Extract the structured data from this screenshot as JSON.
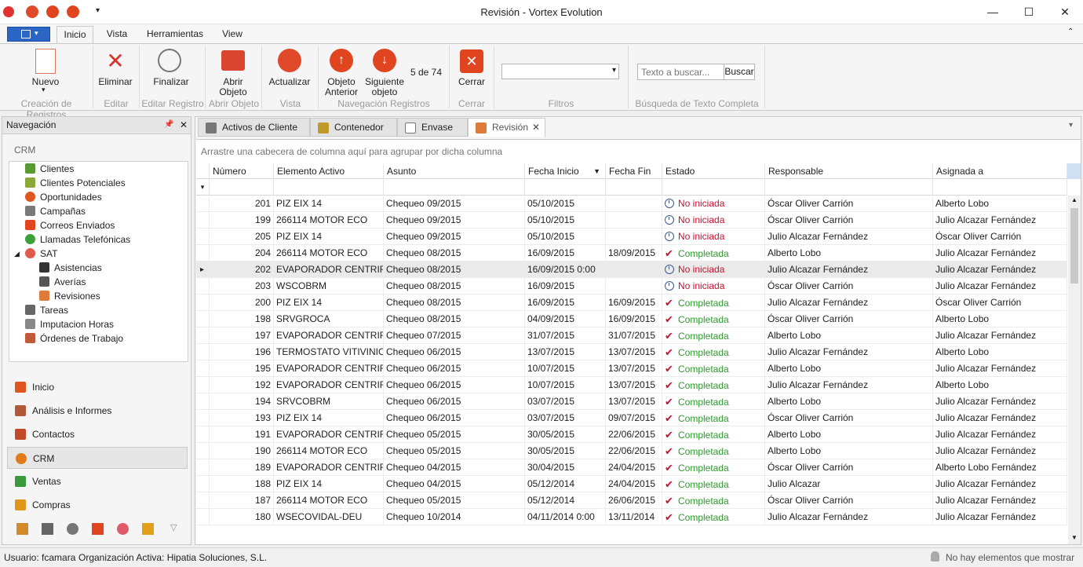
{
  "window": {
    "title": "Revisión - Vortex Evolution"
  },
  "ribbon_tabs": [
    "Inicio",
    "Vista",
    "Herramientas",
    "View"
  ],
  "ribbon": {
    "buttons": {
      "nuevo": "Nuevo",
      "eliminar": "Eliminar",
      "finalizar": "Finalizar",
      "abrir": "Abrir Objeto",
      "actualizar": "Actualizar",
      "anterior": "Objeto Anterior",
      "siguiente": "Siguiente objeto",
      "counter": "5 de 74",
      "cerrar": "Cerrar",
      "buscar": "Buscar"
    },
    "groups": {
      "creacion": "Creación de Registros",
      "editar": "Editar",
      "editar_registro": "Editar Registro",
      "abrir": "Abrir Objeto",
      "vista": "Vista",
      "navegacion": "Navegación Registros",
      "cerrar": "Cerrar",
      "filtros": "Filtros",
      "busqueda": "Búsqueda de Texto Completa"
    },
    "search_placeholder": "Texto a buscar..."
  },
  "nav": {
    "title": "Navegación",
    "section": "CRM",
    "tree": [
      "Clientes",
      "Clientes Potenciales",
      "Oportunidades",
      "Campañas",
      "Correos Enviados",
      "Llamadas Telefónicas",
      "SAT",
      "Asistencias",
      "Averías",
      "Revisiones",
      "Tareas",
      "Imputacion Horas",
      "Órdenes de Trabajo"
    ],
    "buttons": [
      "Inicio",
      "Análisis e Informes",
      "Contactos",
      "CRM",
      "Ventas",
      "Compras"
    ]
  },
  "doc_tabs": [
    "Activos de Cliente",
    "Contenedor",
    "Envase",
    "Revisión"
  ],
  "grid": {
    "group_hint": "Arrastre una cabecera de columna aquí para agrupar por dicha columna",
    "columns": [
      "Número",
      "Elemento Activo",
      "Asunto",
      "Fecha Inicio",
      "Fecha Fin",
      "Estado",
      "Responsable",
      "Asignada a"
    ],
    "rows": [
      [
        "201",
        "PIZ EIX 14",
        "Chequeo 09/2015",
        "05/10/2015",
        "",
        "No iniciada",
        "Óscar Oliver Carrión",
        "Alberto Lobo"
      ],
      [
        "199",
        "266114 MOTOR ECO",
        "Chequeo 09/2015",
        "05/10/2015",
        "",
        "No iniciada",
        "Óscar Oliver Carrión",
        "Julio Alcazar Fernández"
      ],
      [
        "205",
        "PIZ EIX 14",
        "Chequeo 09/2015",
        "05/10/2015",
        "",
        "No iniciada",
        "Julio Alcazar Fernández",
        "Óscar Oliver Carrión"
      ],
      [
        "204",
        "266114 MOTOR ECO",
        "Chequeo 08/2015",
        "16/09/2015",
        "18/09/2015",
        "Completada",
        "Alberto Lobo",
        "Julio Alcazar Fernández"
      ],
      [
        "202",
        "EVAPORADOR CENTRIF.",
        "Chequeo 08/2015",
        "16/09/2015 0:00",
        "",
        "No iniciada",
        "Julio Alcazar Fernández",
        "Julio Alcazar Fernández"
      ],
      [
        "203",
        "WSCOBRM",
        "Chequeo 08/2015",
        "16/09/2015",
        "",
        "No iniciada",
        "Óscar Oliver Carrión",
        "Julio Alcazar Fernández"
      ],
      [
        "200",
        "PIZ EIX 14",
        "Chequeo 08/2015",
        "16/09/2015",
        "16/09/2015",
        "Completada",
        "Julio Alcazar Fernández",
        "Óscar Oliver Carrión"
      ],
      [
        "198",
        "SRVGROCA",
        "Chequeo 08/2015",
        "04/09/2015",
        "16/09/2015",
        "Completada",
        "Óscar Oliver Carrión",
        "Alberto Lobo"
      ],
      [
        "197",
        "EVAPORADOR CENTRIF.",
        "Chequeo 07/2015",
        "31/07/2015",
        "31/07/2015",
        "Completada",
        "Alberto Lobo",
        "Julio Alcazar Fernández"
      ],
      [
        "196",
        "TERMOSTATO VITIVINIC.",
        "Chequeo 06/2015",
        "13/07/2015",
        "13/07/2015",
        "Completada",
        "Julio Alcazar Fernández",
        "Alberto Lobo"
      ],
      [
        "195",
        "EVAPORADOR CENTRIF.",
        "Chequeo 06/2015",
        "10/07/2015",
        "13/07/2015",
        "Completada",
        "Alberto Lobo",
        "Julio Alcazar Fernández"
      ],
      [
        "192",
        "EVAPORADOR CENTRIF.",
        "Chequeo 06/2015",
        "10/07/2015",
        "13/07/2015",
        "Completada",
        "Julio Alcazar Fernández",
        "Alberto Lobo"
      ],
      [
        "194",
        "SRVCOBRM",
        "Chequeo 06/2015",
        "03/07/2015",
        "13/07/2015",
        "Completada",
        "Alberto Lobo",
        "Julio Alcazar Fernández"
      ],
      [
        "193",
        "PIZ EIX 14",
        "Chequeo 06/2015",
        "03/07/2015",
        "09/07/2015",
        "Completada",
        "Óscar Oliver Carrión",
        "Julio Alcazar Fernández"
      ],
      [
        "191",
        "EVAPORADOR CENTRIF.",
        "Chequeo 05/2015",
        "30/05/2015",
        "22/06/2015",
        "Completada",
        "Alberto Lobo",
        "Julio Alcazar Fernández"
      ],
      [
        "190",
        "266114 MOTOR ECO",
        "Chequeo 05/2015",
        "30/05/2015",
        "22/06/2015",
        "Completada",
        "Alberto Lobo",
        "Julio Alcazar Fernández"
      ],
      [
        "189",
        "EVAPORADOR CENTRIF.",
        "Chequeo 04/2015",
        "30/04/2015",
        "24/04/2015",
        "Completada",
        "Óscar Oliver Carrión",
        "Alberto Lobo Fernández"
      ],
      [
        "188",
        "PIZ EIX 14",
        "Chequeo 04/2015",
        "05/12/2014",
        "24/04/2015",
        "Completada",
        "Julio Alcazar",
        "Julio Alcazar Fernández"
      ],
      [
        "187",
        "266114 MOTOR ECO",
        "Chequeo 05/2015",
        "05/12/2014",
        "26/06/2015",
        "Completada",
        "Óscar Oliver Carrión",
        "Julio Alcazar Fernández"
      ],
      [
        "180",
        "WSECOVIDAL-DEU",
        "Chequeo 10/2014",
        "04/11/2014 0:00",
        "13/11/2014",
        "Completada",
        "Julio Alcazar Fernández",
        "Julio Alcazar Fernández"
      ]
    ]
  },
  "status": {
    "user": "Usuario: fcamara",
    "org": "Organización Activa: Hipatia Soluciones, S.L.",
    "right": "No hay elementos que mostrar"
  },
  "colors": {
    "accent": "#2b65c6",
    "red": "#c8102e",
    "green": "#2e9a2e"
  }
}
